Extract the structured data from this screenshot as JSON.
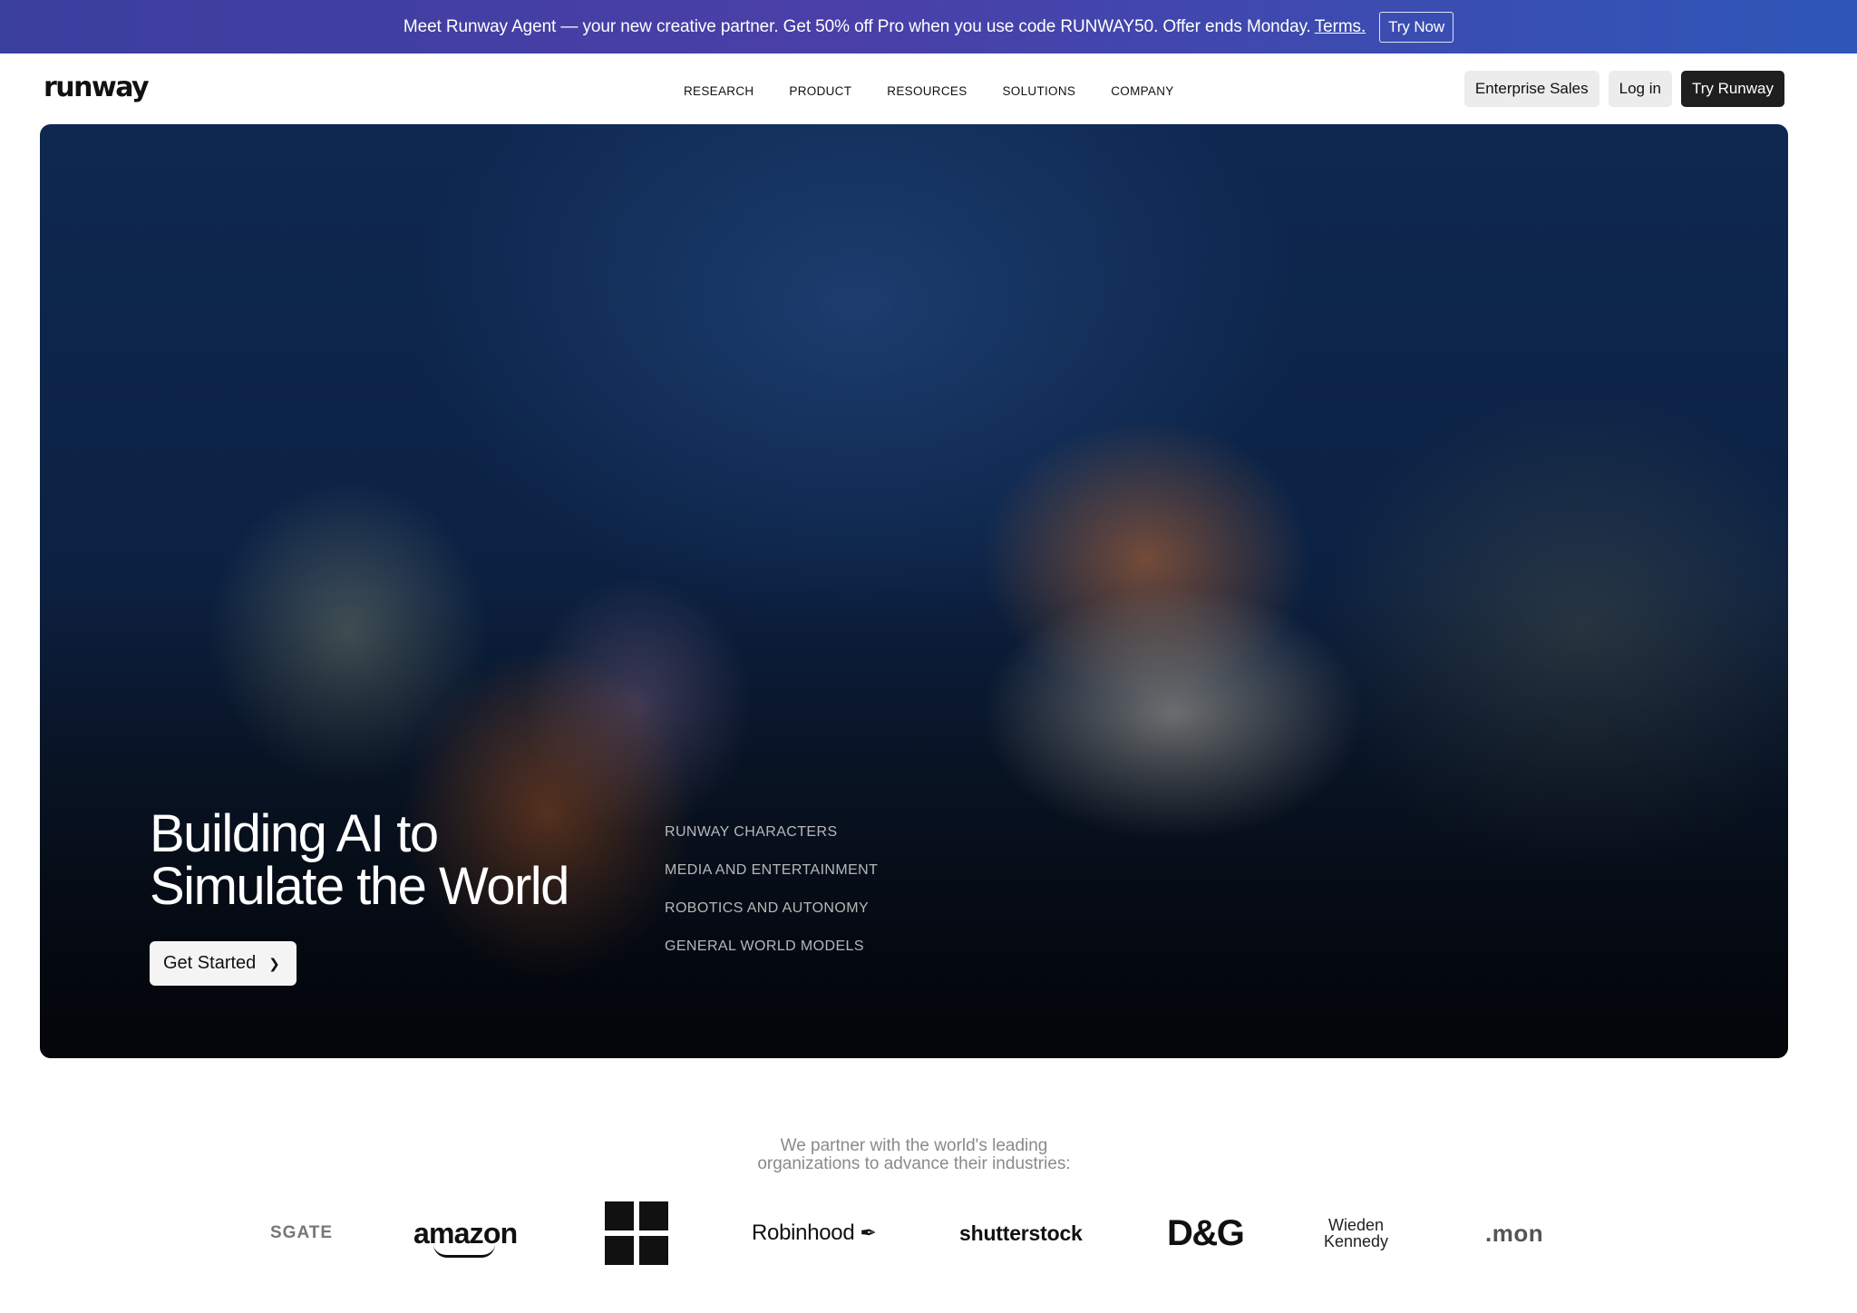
{
  "promo": {
    "message": "Meet Runway Agent — your new creative partner. Get 50% off Pro when you use code RUNWAY50. Offer ends Monday.",
    "terms_label": "Terms.",
    "cta_label": "Try Now"
  },
  "nav": {
    "logo": "runway",
    "menu": [
      "RESEARCH",
      "PRODUCT",
      "RESOURCES",
      "SOLUTIONS",
      "COMPANY"
    ],
    "enterprise_label": "Enterprise Sales",
    "login_label": "Log in",
    "try_label": "Try Runway"
  },
  "hero": {
    "title_line1": "Building AI to",
    "title_line2": "Simulate the World",
    "cta_label": "Get Started",
    "links": [
      "RUNWAY CHARACTERS",
      "MEDIA AND ENTERTAINMENT",
      "ROBOTICS AND AUTONOMY",
      "GENERAL WORLD MODELS"
    ]
  },
  "partners": {
    "line1": "We partner with the world's leading",
    "line2": "organizations to advance their industries:",
    "logos": {
      "sgate": "SGATE",
      "amazon": "amazon",
      "robinhood": "Robinhood",
      "shutterstock": "shutterstock",
      "dg": "D&G",
      "wieden_1": "Wieden",
      "wieden_2": "Kennedy",
      "mon": ".mon"
    }
  },
  "icons": {
    "chevron": "chevron-right-icon",
    "microsoft": "microsoft-logo-icon",
    "feather": "feather-icon"
  }
}
